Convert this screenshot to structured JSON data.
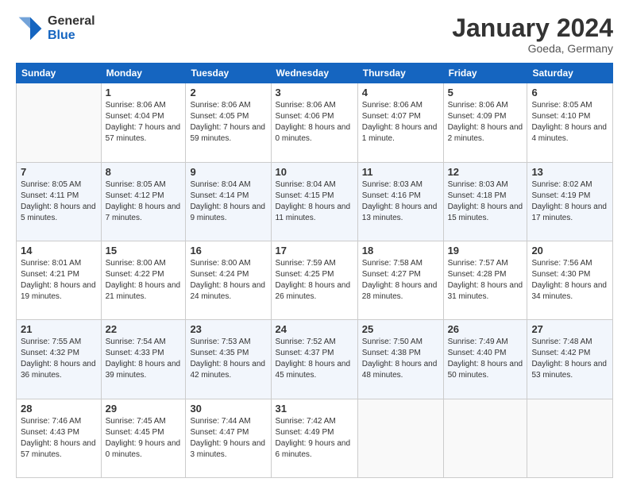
{
  "header": {
    "logo_general": "General",
    "logo_blue": "Blue",
    "month_title": "January 2024",
    "location": "Goeda, Germany"
  },
  "days_of_week": [
    "Sunday",
    "Monday",
    "Tuesday",
    "Wednesday",
    "Thursday",
    "Friday",
    "Saturday"
  ],
  "weeks": [
    [
      {
        "day": "",
        "sunrise": "",
        "sunset": "",
        "daylight": ""
      },
      {
        "day": "1",
        "sunrise": "Sunrise: 8:06 AM",
        "sunset": "Sunset: 4:04 PM",
        "daylight": "Daylight: 7 hours and 57 minutes."
      },
      {
        "day": "2",
        "sunrise": "Sunrise: 8:06 AM",
        "sunset": "Sunset: 4:05 PM",
        "daylight": "Daylight: 7 hours and 59 minutes."
      },
      {
        "day": "3",
        "sunrise": "Sunrise: 8:06 AM",
        "sunset": "Sunset: 4:06 PM",
        "daylight": "Daylight: 8 hours and 0 minutes."
      },
      {
        "day": "4",
        "sunrise": "Sunrise: 8:06 AM",
        "sunset": "Sunset: 4:07 PM",
        "daylight": "Daylight: 8 hours and 1 minute."
      },
      {
        "day": "5",
        "sunrise": "Sunrise: 8:06 AM",
        "sunset": "Sunset: 4:09 PM",
        "daylight": "Daylight: 8 hours and 2 minutes."
      },
      {
        "day": "6",
        "sunrise": "Sunrise: 8:05 AM",
        "sunset": "Sunset: 4:10 PM",
        "daylight": "Daylight: 8 hours and 4 minutes."
      }
    ],
    [
      {
        "day": "7",
        "sunrise": "Sunrise: 8:05 AM",
        "sunset": "Sunset: 4:11 PM",
        "daylight": "Daylight: 8 hours and 5 minutes."
      },
      {
        "day": "8",
        "sunrise": "Sunrise: 8:05 AM",
        "sunset": "Sunset: 4:12 PM",
        "daylight": "Daylight: 8 hours and 7 minutes."
      },
      {
        "day": "9",
        "sunrise": "Sunrise: 8:04 AM",
        "sunset": "Sunset: 4:14 PM",
        "daylight": "Daylight: 8 hours and 9 minutes."
      },
      {
        "day": "10",
        "sunrise": "Sunrise: 8:04 AM",
        "sunset": "Sunset: 4:15 PM",
        "daylight": "Daylight: 8 hours and 11 minutes."
      },
      {
        "day": "11",
        "sunrise": "Sunrise: 8:03 AM",
        "sunset": "Sunset: 4:16 PM",
        "daylight": "Daylight: 8 hours and 13 minutes."
      },
      {
        "day": "12",
        "sunrise": "Sunrise: 8:03 AM",
        "sunset": "Sunset: 4:18 PM",
        "daylight": "Daylight: 8 hours and 15 minutes."
      },
      {
        "day": "13",
        "sunrise": "Sunrise: 8:02 AM",
        "sunset": "Sunset: 4:19 PM",
        "daylight": "Daylight: 8 hours and 17 minutes."
      }
    ],
    [
      {
        "day": "14",
        "sunrise": "Sunrise: 8:01 AM",
        "sunset": "Sunset: 4:21 PM",
        "daylight": "Daylight: 8 hours and 19 minutes."
      },
      {
        "day": "15",
        "sunrise": "Sunrise: 8:00 AM",
        "sunset": "Sunset: 4:22 PM",
        "daylight": "Daylight: 8 hours and 21 minutes."
      },
      {
        "day": "16",
        "sunrise": "Sunrise: 8:00 AM",
        "sunset": "Sunset: 4:24 PM",
        "daylight": "Daylight: 8 hours and 24 minutes."
      },
      {
        "day": "17",
        "sunrise": "Sunrise: 7:59 AM",
        "sunset": "Sunset: 4:25 PM",
        "daylight": "Daylight: 8 hours and 26 minutes."
      },
      {
        "day": "18",
        "sunrise": "Sunrise: 7:58 AM",
        "sunset": "Sunset: 4:27 PM",
        "daylight": "Daylight: 8 hours and 28 minutes."
      },
      {
        "day": "19",
        "sunrise": "Sunrise: 7:57 AM",
        "sunset": "Sunset: 4:28 PM",
        "daylight": "Daylight: 8 hours and 31 minutes."
      },
      {
        "day": "20",
        "sunrise": "Sunrise: 7:56 AM",
        "sunset": "Sunset: 4:30 PM",
        "daylight": "Daylight: 8 hours and 34 minutes."
      }
    ],
    [
      {
        "day": "21",
        "sunrise": "Sunrise: 7:55 AM",
        "sunset": "Sunset: 4:32 PM",
        "daylight": "Daylight: 8 hours and 36 minutes."
      },
      {
        "day": "22",
        "sunrise": "Sunrise: 7:54 AM",
        "sunset": "Sunset: 4:33 PM",
        "daylight": "Daylight: 8 hours and 39 minutes."
      },
      {
        "day": "23",
        "sunrise": "Sunrise: 7:53 AM",
        "sunset": "Sunset: 4:35 PM",
        "daylight": "Daylight: 8 hours and 42 minutes."
      },
      {
        "day": "24",
        "sunrise": "Sunrise: 7:52 AM",
        "sunset": "Sunset: 4:37 PM",
        "daylight": "Daylight: 8 hours and 45 minutes."
      },
      {
        "day": "25",
        "sunrise": "Sunrise: 7:50 AM",
        "sunset": "Sunset: 4:38 PM",
        "daylight": "Daylight: 8 hours and 48 minutes."
      },
      {
        "day": "26",
        "sunrise": "Sunrise: 7:49 AM",
        "sunset": "Sunset: 4:40 PM",
        "daylight": "Daylight: 8 hours and 50 minutes."
      },
      {
        "day": "27",
        "sunrise": "Sunrise: 7:48 AM",
        "sunset": "Sunset: 4:42 PM",
        "daylight": "Daylight: 8 hours and 53 minutes."
      }
    ],
    [
      {
        "day": "28",
        "sunrise": "Sunrise: 7:46 AM",
        "sunset": "Sunset: 4:43 PM",
        "daylight": "Daylight: 8 hours and 57 minutes."
      },
      {
        "day": "29",
        "sunrise": "Sunrise: 7:45 AM",
        "sunset": "Sunset: 4:45 PM",
        "daylight": "Daylight: 9 hours and 0 minutes."
      },
      {
        "day": "30",
        "sunrise": "Sunrise: 7:44 AM",
        "sunset": "Sunset: 4:47 PM",
        "daylight": "Daylight: 9 hours and 3 minutes."
      },
      {
        "day": "31",
        "sunrise": "Sunrise: 7:42 AM",
        "sunset": "Sunset: 4:49 PM",
        "daylight": "Daylight: 9 hours and 6 minutes."
      },
      {
        "day": "",
        "sunrise": "",
        "sunset": "",
        "daylight": ""
      },
      {
        "day": "",
        "sunrise": "",
        "sunset": "",
        "daylight": ""
      },
      {
        "day": "",
        "sunrise": "",
        "sunset": "",
        "daylight": ""
      }
    ]
  ]
}
